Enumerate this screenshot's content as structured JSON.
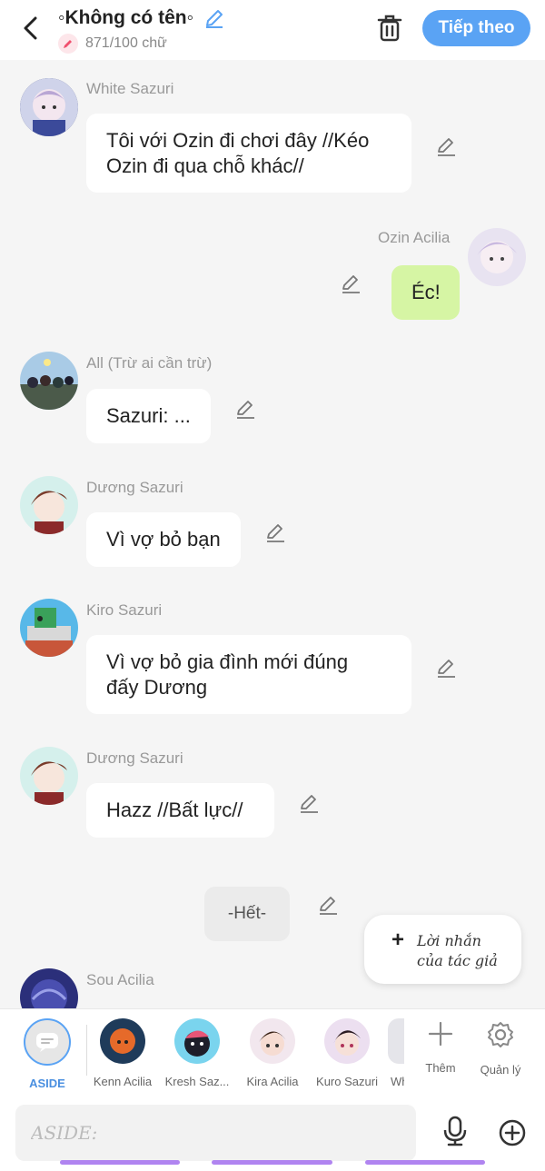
{
  "header": {
    "title": "◦Không có tên◦",
    "word_count": "871/100 chữ",
    "next_label": "Tiếp theo"
  },
  "messages": [
    {
      "name": "White Sazuri",
      "line1": "Tôi với Ozin đi chơi đây //Kéo",
      "line2": "Ozin đi qua chỗ khác//"
    },
    {
      "name": "Ozin Acilia",
      "text": "Éc!"
    },
    {
      "name": "All (Trừ ai cần trừ)",
      "text": "Sazuri: ..."
    },
    {
      "name": "Dương Sazuri",
      "text": "Vì vợ bỏ bạn"
    },
    {
      "name": "Kiro Sazuri",
      "line1": "Vì vợ bỏ gia đình mới đúng",
      "line2": "đấy Dương"
    },
    {
      "name": "Dương Sazuri",
      "text": "Hazz //Bất lực//"
    },
    {
      "text": "-Hết-"
    },
    {
      "name": "Sou Acilia"
    }
  ],
  "author_note": {
    "line1": "Lời nhắn",
    "line2": "của tác giả"
  },
  "characters": [
    {
      "label": "ASIDE"
    },
    {
      "label": "Kenn Acilia"
    },
    {
      "label": "Kresh Saz..."
    },
    {
      "label": "Kira Acilia"
    },
    {
      "label": "Kuro Sazuri"
    },
    {
      "label": "Wh"
    }
  ],
  "tools": {
    "add_label": "Thêm",
    "manage_label": "Quản lý"
  },
  "input": {
    "placeholder": "ASIDE:"
  },
  "colors": {
    "accent": "#5aa3f4",
    "my_bubble": "#d6f5a4",
    "underline": "#b084f0"
  }
}
